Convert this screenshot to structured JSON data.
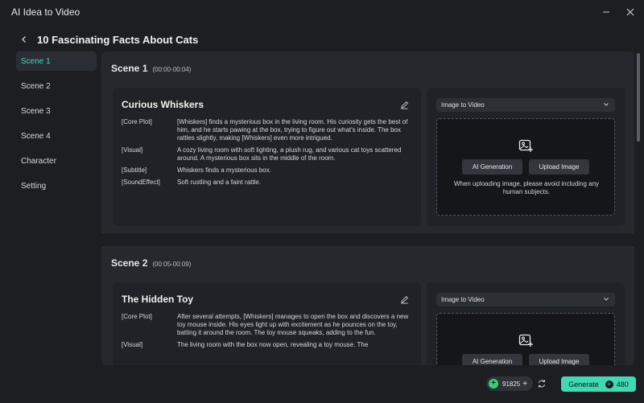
{
  "window": {
    "title": "AI Idea to Video",
    "minimize_glyph": "—",
    "close_glyph": "✕"
  },
  "header": {
    "title": "10 Fascinating Facts About Cats"
  },
  "sidebar": {
    "items": [
      {
        "label": "Scene 1",
        "active": true
      },
      {
        "label": "Scene 2"
      },
      {
        "label": "Scene 3"
      },
      {
        "label": "Scene 4"
      },
      {
        "label": "Character"
      },
      {
        "label": "Setting"
      }
    ]
  },
  "scenes": [
    {
      "name": "Scene 1",
      "time": "(00:00-00:04)",
      "title": "Curious Whiskers",
      "fields": [
        {
          "key": "[Core Plot]",
          "value": "[Whiskers] finds a mysterious box in the living room. His curiosity gets the best of him, and he starts pawing at the box, trying to figure out what's inside. The box rattles slightly, making [Whiskers] even more intrigued."
        },
        {
          "key": "[Visual]",
          "value": "A cozy living room with soft lighting, a plush rug, and various cat toys scattered around. A mysterious box sits in the middle of the room."
        },
        {
          "key": "[Subtitle]",
          "value": "Whiskers finds a mysterious box."
        },
        {
          "key": "[SoundEffect]",
          "value": "Soft rustling and a faint rattle."
        }
      ],
      "media": {
        "select_value": "Image to Video",
        "ai_button": "AI Generation",
        "upload_button": "Upload Image",
        "hint": "When uploading image, please avoid including any human subjects."
      }
    },
    {
      "name": "Scene 2",
      "time": "(00:05-00:09)",
      "title": "The Hidden Toy",
      "fields": [
        {
          "key": "[Core Plot]",
          "value": "After several attempts, [Whiskers] manages to open the box and discovers a new toy mouse inside. His eyes light up with excitement as he pounces on the toy, batting it around the room. The toy mouse squeaks, adding to the fun."
        },
        {
          "key": "[Visual]",
          "value": "The living room with the box now open, revealing a toy mouse. The"
        }
      ],
      "media": {
        "select_value": "Image to Video",
        "ai_button": "AI Generation",
        "upload_button": "Upload Image"
      }
    }
  ],
  "footer": {
    "credits": "91825",
    "credits_plus": "+",
    "generate_label": "Generate",
    "generate_cost": "480"
  },
  "colors": {
    "accent": "#3fd9b3",
    "coin": "#36d17a",
    "background": "#1c1e22",
    "panel": "#25282d",
    "card": "#1f2226"
  }
}
